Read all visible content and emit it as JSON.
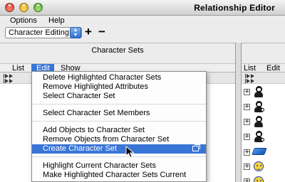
{
  "window": {
    "title": "Relationship Editor"
  },
  "menubar": {
    "options": "Options",
    "help": "Help"
  },
  "toolbar": {
    "mode_select": "Character Editing",
    "add_label": "+",
    "remove_label": "−"
  },
  "left_panel": {
    "title": "Character Sets",
    "tabs": [
      "List",
      "Edit",
      "Show"
    ]
  },
  "right_panel": {
    "tabs": [
      "List",
      "Edit"
    ]
  },
  "edit_menu": {
    "items": [
      "Delete Highlighted Character Sets",
      "Remove Highlighted Attributes",
      "Select Character Set",
      "Select Character Set Members",
      "Add Objects to Character Set",
      "Remove Objects from Character Set",
      "Create Character Set",
      "Highlight Current Character Sets",
      "Make Highlighted Character Sets Current"
    ],
    "highlighted_item": "Create Character Set"
  },
  "colors": {
    "selection": "#3875d7",
    "menu_bg": "#fdfdfd"
  }
}
